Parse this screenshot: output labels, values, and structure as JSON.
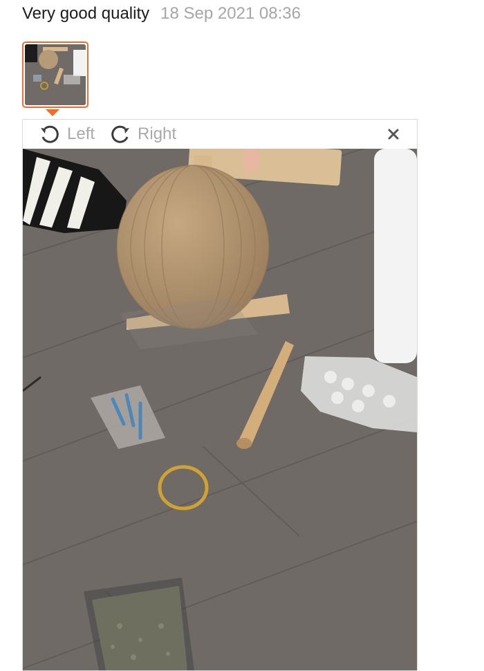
{
  "review": {
    "title": "Very good quality",
    "date": "18 Sep 2021 08:36"
  },
  "viewer": {
    "rotate_left_label": "Left",
    "rotate_right_label": "Right",
    "close_icon": "close-icon"
  },
  "colors": {
    "accent": "#ef6c2d",
    "muted_text": "#a6a6a6"
  }
}
